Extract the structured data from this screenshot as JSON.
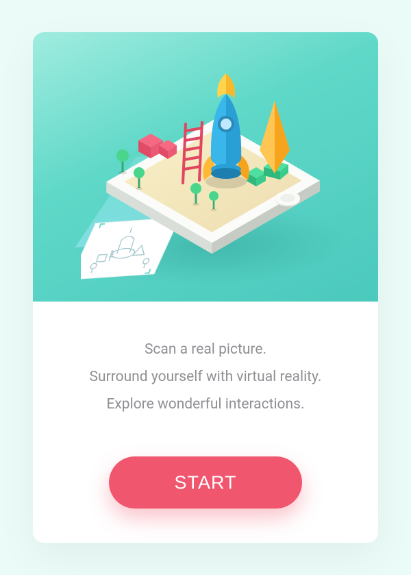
{
  "hero": {
    "illustration_name": "ar-phone-scene",
    "icons": {
      "phone": "phone-isometric-icon",
      "rocket": "rocket-icon",
      "ladder": "ladder-icon",
      "shard": "crystal-icon",
      "cube": "cube-icon",
      "tree": "tree-icon",
      "paper": "sketch-paper-icon",
      "beam": "projection-beam-icon",
      "home": "home-button-icon"
    }
  },
  "content": {
    "line1": "Scan a real picture.",
    "line2": "Surround yourself with virtual reality.",
    "line3": "Explore wonderful interactions."
  },
  "cta": {
    "label": "START"
  },
  "colors": {
    "accent": "#f0566e",
    "hero_gradient_from": "#a0ecdf",
    "hero_gradient_to": "#4bc9bd",
    "text": "#8f8f94"
  }
}
